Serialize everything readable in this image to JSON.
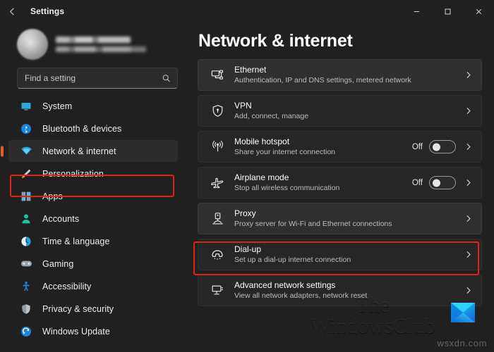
{
  "window": {
    "app_title": "Settings",
    "back_icon": "back-arrow-icon",
    "minimize_label": "—",
    "maximize_label": "□",
    "close_label": "✕"
  },
  "sidebar": {
    "profile": {
      "name": "",
      "email": "",
      "redacted": true
    },
    "search": {
      "placeholder": "Find a setting",
      "value": "",
      "icon": "search-icon"
    },
    "items": [
      {
        "label": "System",
        "icon": "monitor-icon",
        "active": false
      },
      {
        "label": "Bluetooth & devices",
        "icon": "bluetooth-icon",
        "active": false
      },
      {
        "label": "Network & internet",
        "icon": "wifi-icon",
        "active": true
      },
      {
        "label": "Personalization",
        "icon": "paintbrush-icon",
        "active": false
      },
      {
        "label": "Apps",
        "icon": "apps-grid-icon",
        "active": false
      },
      {
        "label": "Accounts",
        "icon": "person-icon",
        "active": false
      },
      {
        "label": "Time & language",
        "icon": "clock-icon",
        "active": false
      },
      {
        "label": "Gaming",
        "icon": "gamepad-icon",
        "active": false
      },
      {
        "label": "Accessibility",
        "icon": "accessibility-icon",
        "active": false
      },
      {
        "label": "Privacy & security",
        "icon": "shield-icon",
        "active": false
      },
      {
        "label": "Windows Update",
        "icon": "update-icon",
        "active": false
      }
    ]
  },
  "main": {
    "title": "Network & internet",
    "cards": [
      {
        "title": "Ethernet",
        "subtitle": "Authentication, IP and DNS settings, metered network",
        "icon": "ethernet-icon",
        "hover": true,
        "toggle": null,
        "toggle_state": null,
        "chevron": "chevron-right-icon"
      },
      {
        "title": "VPN",
        "subtitle": "Add, connect, manage",
        "icon": "vpn-shield-icon",
        "hover": false,
        "toggle": null,
        "toggle_state": null,
        "chevron": "chevron-right-icon"
      },
      {
        "title": "Mobile hotspot",
        "subtitle": "Share your internet connection",
        "icon": "hotspot-antenna-icon",
        "hover": false,
        "toggle": "Off",
        "toggle_state": "off",
        "chevron": "chevron-right-icon"
      },
      {
        "title": "Airplane mode",
        "subtitle": "Stop all wireless communication",
        "icon": "airplane-icon",
        "hover": false,
        "toggle": "Off",
        "toggle_state": "off",
        "chevron": "chevron-right-icon"
      },
      {
        "title": "Proxy",
        "subtitle": "Proxy server for Wi-Fi and Ethernet connections",
        "icon": "proxy-server-icon",
        "hover": true,
        "toggle": null,
        "toggle_state": null,
        "chevron": "chevron-right-icon"
      },
      {
        "title": "Dial-up",
        "subtitle": "Set up a dial-up internet connection",
        "icon": "dialup-phone-icon",
        "hover": false,
        "toggle": null,
        "toggle_state": null,
        "chevron": "chevron-right-icon"
      },
      {
        "title": "Advanced network settings",
        "subtitle": "View all network adapters, network reset",
        "icon": "advanced-network-icon",
        "hover": false,
        "toggle": null,
        "toggle_state": null,
        "chevron": "chevron-right-icon"
      }
    ]
  },
  "annotations": {
    "highlight_color": "#e02318",
    "highlighted_sidebar_item": "Network & internet",
    "highlighted_card": "Proxy"
  },
  "watermark": {
    "brand_line1": "The",
    "brand_line2": "WindowsClub",
    "site": "wsxdn.com",
    "logo": "windowsclub-logo-icon"
  },
  "colors": {
    "window_bg": "#202020",
    "card_bg": "#262626",
    "card_hover_bg": "#2f2f2f",
    "accent_selection": "#e0621d",
    "toggle_on": "#4cc2ff",
    "highlight_red": "#e02318"
  }
}
